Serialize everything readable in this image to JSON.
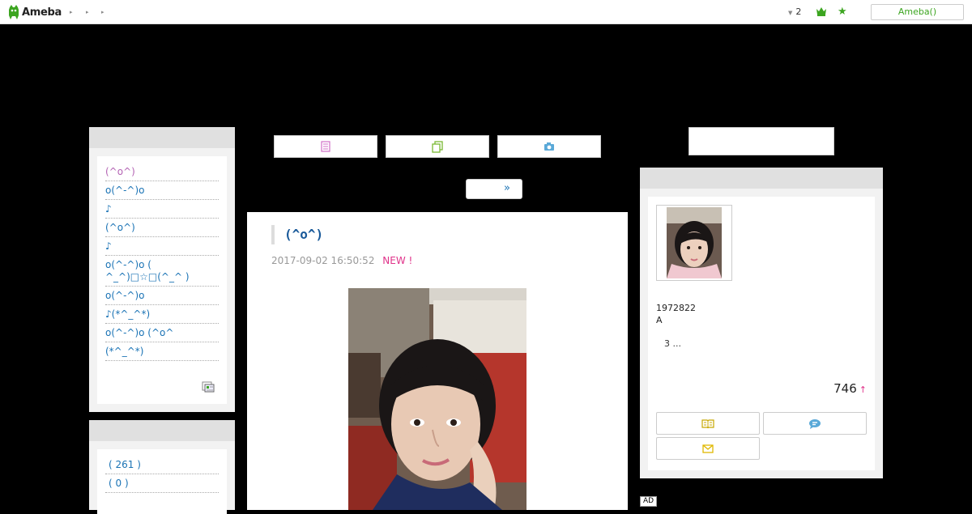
{
  "header": {
    "logo_text": "Ameba",
    "nav_arrows": [
      "▸",
      "▸",
      "▸"
    ],
    "notification_count": "2",
    "account_button": "Ameba()"
  },
  "sidebar": {
    "recent_entries": [
      "(^o^)",
      "o(^-^)o",
      "♪",
      "(^o^)",
      "♪",
      "o(^-^)o ( ^_^)□☆□(^_^ )",
      "o(^-^)o",
      "♪(*^_^*)",
      "o(^-^)o (^o^",
      "(*^_^*)"
    ],
    "themes": [
      "( 261 )",
      "( 0 )"
    ]
  },
  "nav": {
    "next_label": "»"
  },
  "article": {
    "title": "(^o^)",
    "date": "2017-09-02 16:50:52",
    "new_badge": "NEW !"
  },
  "profile": {
    "id_line1": "1972822",
    "id_line2": "A",
    "description": "3 ...",
    "reader_count": "746",
    "up_mark": "↑"
  },
  "ad_label": "AD",
  "colors": {
    "accent_green": "#3ca520",
    "link_blue": "#1a73b5",
    "new_pink": "#e0338a",
    "first_entry_purple": "#b464b4"
  }
}
